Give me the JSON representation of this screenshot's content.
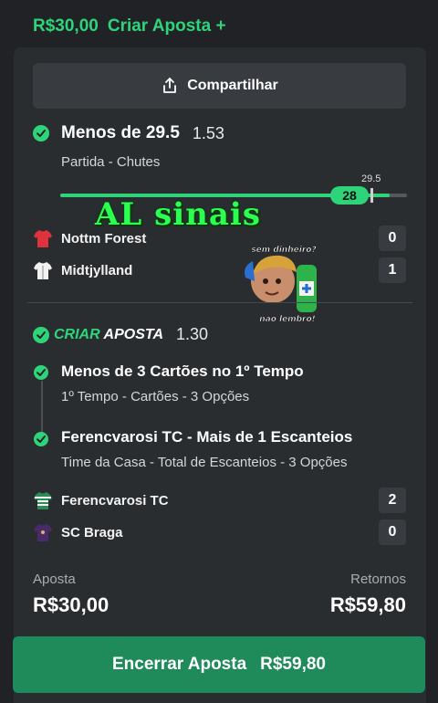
{
  "header": {
    "amount": "R$30,00",
    "create_label": "Criar Aposta +"
  },
  "share": {
    "label": "Compartilhar",
    "icon": "share-icon"
  },
  "selection": {
    "title": "Menos de 29.5",
    "odd": "1.53",
    "subtitle": "Partida - Chutes",
    "progress": {
      "current": "28",
      "target": "29.5",
      "fraction": 0.949
    }
  },
  "watermark": "AL sinais",
  "match1": {
    "home": {
      "name": "Nottm Forest",
      "score": "0",
      "shirt_color": "#e0323c"
    },
    "away": {
      "name": "Midtjylland",
      "score": "1",
      "shirt_color": "#f2f2f2"
    }
  },
  "sticker": {
    "top_text": "sem dinheiro?",
    "bottom_text": "não lembro!"
  },
  "bet_builder": {
    "label_green": "CRIAR",
    "label_white": "APOSTA",
    "odd": "1.30",
    "legs": [
      {
        "title": "Menos de 3 Cartões no 1º Tempo",
        "subtitle": "1º Tempo - Cartões - 3 Opções"
      },
      {
        "title": "Ferencvarosi TC - Mais de 1 Escanteios",
        "subtitle": "Time da Casa - Total de Escanteios - 3 Opções"
      }
    ]
  },
  "match2": {
    "home": {
      "name": "Ferencvarosi TC",
      "score": "2",
      "shirt_color": "#2e8b57"
    },
    "away": {
      "name": "SC Braga",
      "score": "0",
      "shirt_color": "#4b2a6a"
    }
  },
  "summary": {
    "stake_label": "Aposta",
    "stake_value": "R$30,00",
    "returns_label": "Retornos",
    "returns_value": "R$59,80"
  },
  "cashout": {
    "label": "Encerrar Aposta",
    "amount": "R$59,80"
  },
  "colors": {
    "accent": "#2ed47a",
    "background": "#202225",
    "card": "#2a2d30",
    "cta": "#1f8a5a"
  }
}
